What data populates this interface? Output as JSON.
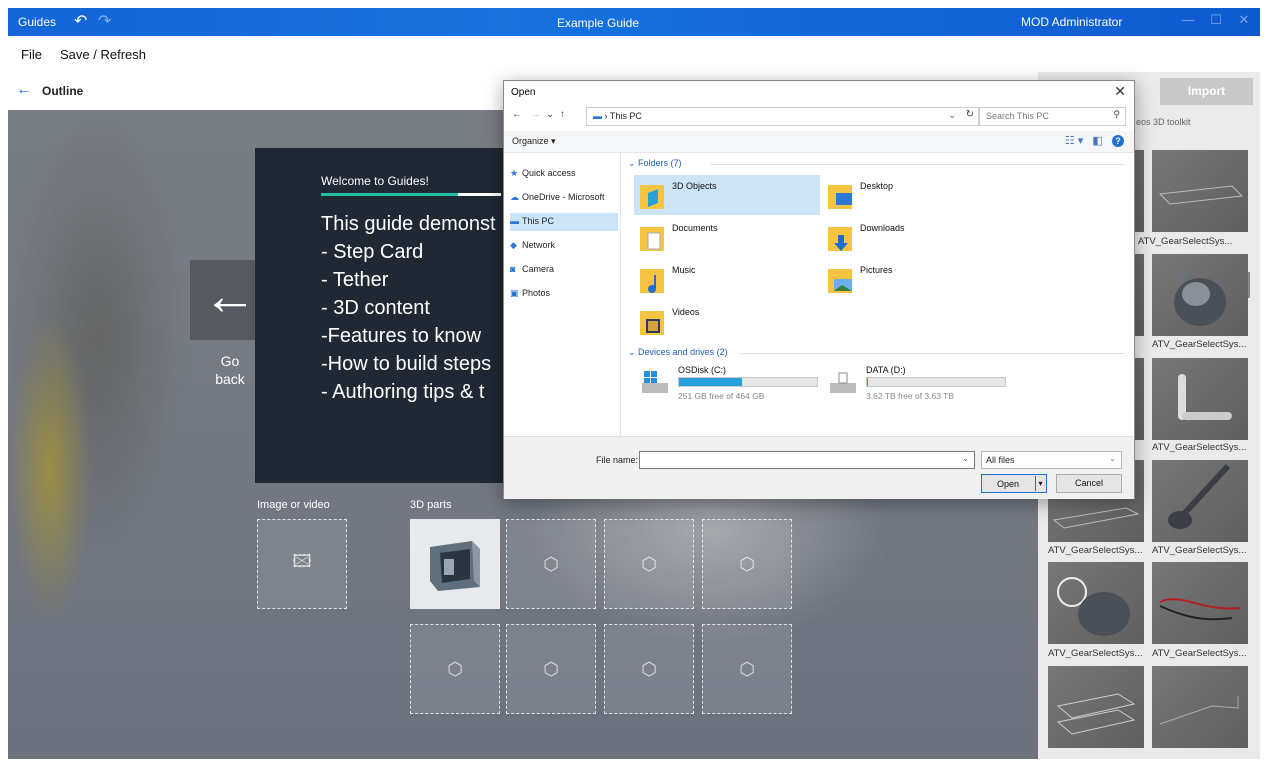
{
  "titlebar": {
    "app_name": "Guides",
    "doc_title": "Example Guide",
    "user": "MOD Administrator"
  },
  "menu": {
    "file": "File",
    "save_refresh": "Save / Refresh"
  },
  "outline": {
    "label": "Outline"
  },
  "canvas": {
    "go_back": "Go\nback",
    "step_card": {
      "welcome": "Welcome to Guides!",
      "progress": 0.76,
      "body": "This guide demonst\n- Step Card\n- Tether\n- 3D content\n-Features to know\n-How to build steps\n- Authoring tips & t"
    },
    "image_or_video_label": "Image or video",
    "parts_label": "3D parts"
  },
  "right_panel": {
    "import": "Import",
    "tabs": "eos  3D toolkit",
    "captions": [
      "ATV_GearSelectSys...",
      "ATV_GearSelectSys...",
      "ATV_GearSelectSys...",
      "ATV_GearSelectSys...",
      "ATV_GearSelectSys...",
      "ATV_GearSelectSys...",
      "ATV_GearSelectSys...",
      "ATV_GearSelectSys...",
      "ATV_GearSelectSys..."
    ]
  },
  "dialog": {
    "title": "Open",
    "address": "This PC",
    "search_placeholder": "Search This PC",
    "organize": "Organize ▾",
    "nav": [
      "Quick access",
      "OneDrive - Microsoft",
      "This PC",
      "Network",
      "Camera",
      "Photos"
    ],
    "folders_header": "Folders (7)",
    "folders": [
      "3D Objects",
      "Desktop",
      "Documents",
      "Downloads",
      "Music",
      "Pictures",
      "Videos"
    ],
    "drives_header": "Devices and drives (2)",
    "drives": [
      {
        "name": "OSDisk (C:)",
        "free": "251 GB free of 464 GB",
        "used_fraction": 0.46
      },
      {
        "name": "DATA (D:)",
        "free": "3.62 TB free of 3.63 TB",
        "used_fraction": 0.01
      }
    ],
    "file_name_label": "File name:",
    "file_type": "All files",
    "open": "Open",
    "cancel": "Cancel"
  },
  "colors": {
    "accent": "#1a73e8",
    "titlebar": "#1565d8",
    "progress": "#1dc0a0",
    "card": "#1f2833"
  }
}
